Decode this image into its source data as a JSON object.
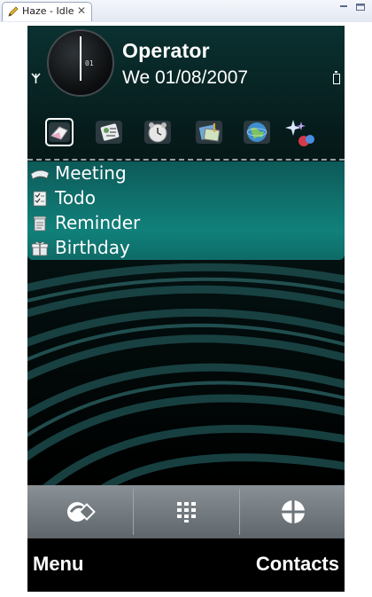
{
  "window": {
    "tab_title": "Haze - Idle",
    "close_glyph": "✕"
  },
  "status": {
    "operator": "Operator",
    "date": "We 01/08/2007",
    "clock_date": "01"
  },
  "shortcuts": [
    {
      "icon": "messaging-icon",
      "selected": true
    },
    {
      "icon": "contacts-card-icon",
      "selected": false
    },
    {
      "icon": "alarm-clock-icon",
      "selected": false
    },
    {
      "icon": "gallery-media-icon",
      "selected": false
    },
    {
      "icon": "web-globe-icon",
      "selected": false
    },
    {
      "icon": "themes-icon",
      "selected": false
    }
  ],
  "calendar": {
    "items": [
      {
        "label": "Meeting",
        "icon": "meeting-icon"
      },
      {
        "label": "Todo",
        "icon": "todo-icon"
      },
      {
        "label": "Reminder",
        "icon": "reminder-icon"
      },
      {
        "label": "Birthday",
        "icon": "birthday-gift-icon"
      }
    ]
  },
  "toolbar": {
    "buttons": [
      {
        "icon": "switch-app-icon"
      },
      {
        "icon": "dialpad-icon"
      },
      {
        "icon": "menu-grid-icon"
      }
    ]
  },
  "softkeys": {
    "left": "Menu",
    "right": "Contacts"
  },
  "colors": {
    "panel_accent": "#0f6e6a",
    "toolbar": "#6e767b"
  }
}
